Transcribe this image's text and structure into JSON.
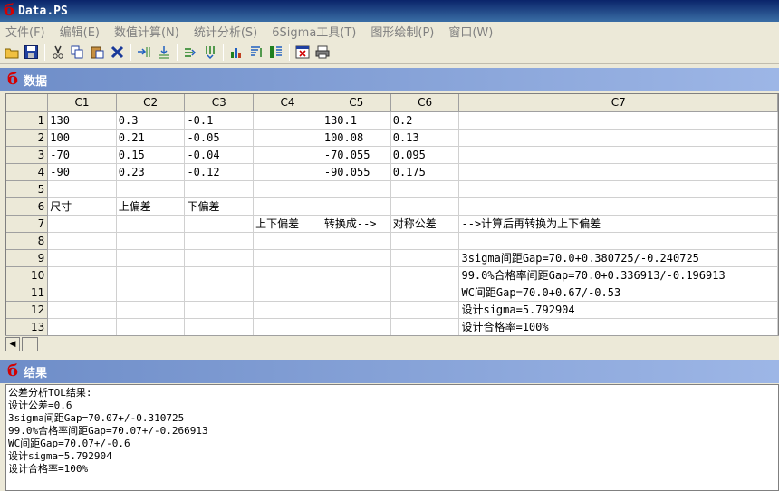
{
  "window": {
    "title": "Data.PS"
  },
  "menu": [
    "文件(F)",
    "编辑(E)",
    "数值计算(N)",
    "统计分析(S)",
    "6Sigma工具(T)",
    "图形绘制(P)",
    "窗口(W)"
  ],
  "toolbar_icons": [
    "open-icon",
    "save-icon",
    "cut-icon",
    "copy-icon",
    "paste-icon",
    "delete-icon",
    "insert-row-icon",
    "insert-col-icon",
    "move-right-icon",
    "move-down-icon",
    "stats-icon",
    "sort-icon",
    "table-icon",
    "close-window-icon",
    "print-icon"
  ],
  "data_pane": {
    "title": "数据",
    "columns": [
      "C1",
      "C2",
      "C3",
      "C4",
      "C5",
      "C6",
      "C7"
    ],
    "rows": [
      {
        "n": "1",
        "c": [
          "130",
          "0.3",
          "-0.1",
          "",
          "130.1",
          "0.2",
          ""
        ]
      },
      {
        "n": "2",
        "c": [
          "100",
          "0.21",
          "-0.05",
          "",
          "100.08",
          "0.13",
          ""
        ]
      },
      {
        "n": "3",
        "c": [
          "-70",
          "0.15",
          "-0.04",
          "",
          "-70.055",
          "0.095",
          ""
        ]
      },
      {
        "n": "4",
        "c": [
          "-90",
          "0.23",
          "-0.12",
          "",
          "-90.055",
          "0.175",
          ""
        ]
      },
      {
        "n": "5",
        "c": [
          "",
          "",
          "",
          "",
          "",
          "",
          ""
        ]
      },
      {
        "n": "6",
        "c": [
          "尺寸",
          "上偏差",
          "下偏差",
          "",
          "",
          "",
          ""
        ]
      },
      {
        "n": "7",
        "c": [
          "",
          "",
          "",
          "上下偏差",
          "转换成-->",
          "对称公差",
          "-->计算后再转换为上下偏差"
        ]
      },
      {
        "n": "8",
        "c": [
          "",
          "",
          "",
          "",
          "",
          "",
          ""
        ]
      },
      {
        "n": "9",
        "c": [
          "",
          "",
          "",
          "",
          "",
          "",
          "3sigma间距Gap=70.0+0.380725/-0.240725"
        ]
      },
      {
        "n": "10",
        "c": [
          "",
          "",
          "",
          "",
          "",
          "",
          "99.0%合格率间距Gap=70.0+0.336913/-0.196913"
        ]
      },
      {
        "n": "11",
        "c": [
          "",
          "",
          "",
          "",
          "",
          "",
          "WC间距Gap=70.0+0.67/-0.53"
        ]
      },
      {
        "n": "12",
        "c": [
          "",
          "",
          "",
          "",
          "",
          "",
          "设计sigma=5.792904"
        ]
      },
      {
        "n": "13",
        "c": [
          "",
          "",
          "",
          "",
          "",
          "",
          "设计合格率=100%"
        ]
      }
    ]
  },
  "result_pane": {
    "title": "结果",
    "lines": [
      "公差分析TOL结果:",
      "设计公差=0.6",
      "3sigma间距Gap=70.07+/-0.310725",
      "99.0%合格率间距Gap=70.07+/-0.266913",
      "WC间距Gap=70.07+/-0.6",
      "设计sigma=5.792904",
      "设计合格率=100%"
    ]
  }
}
